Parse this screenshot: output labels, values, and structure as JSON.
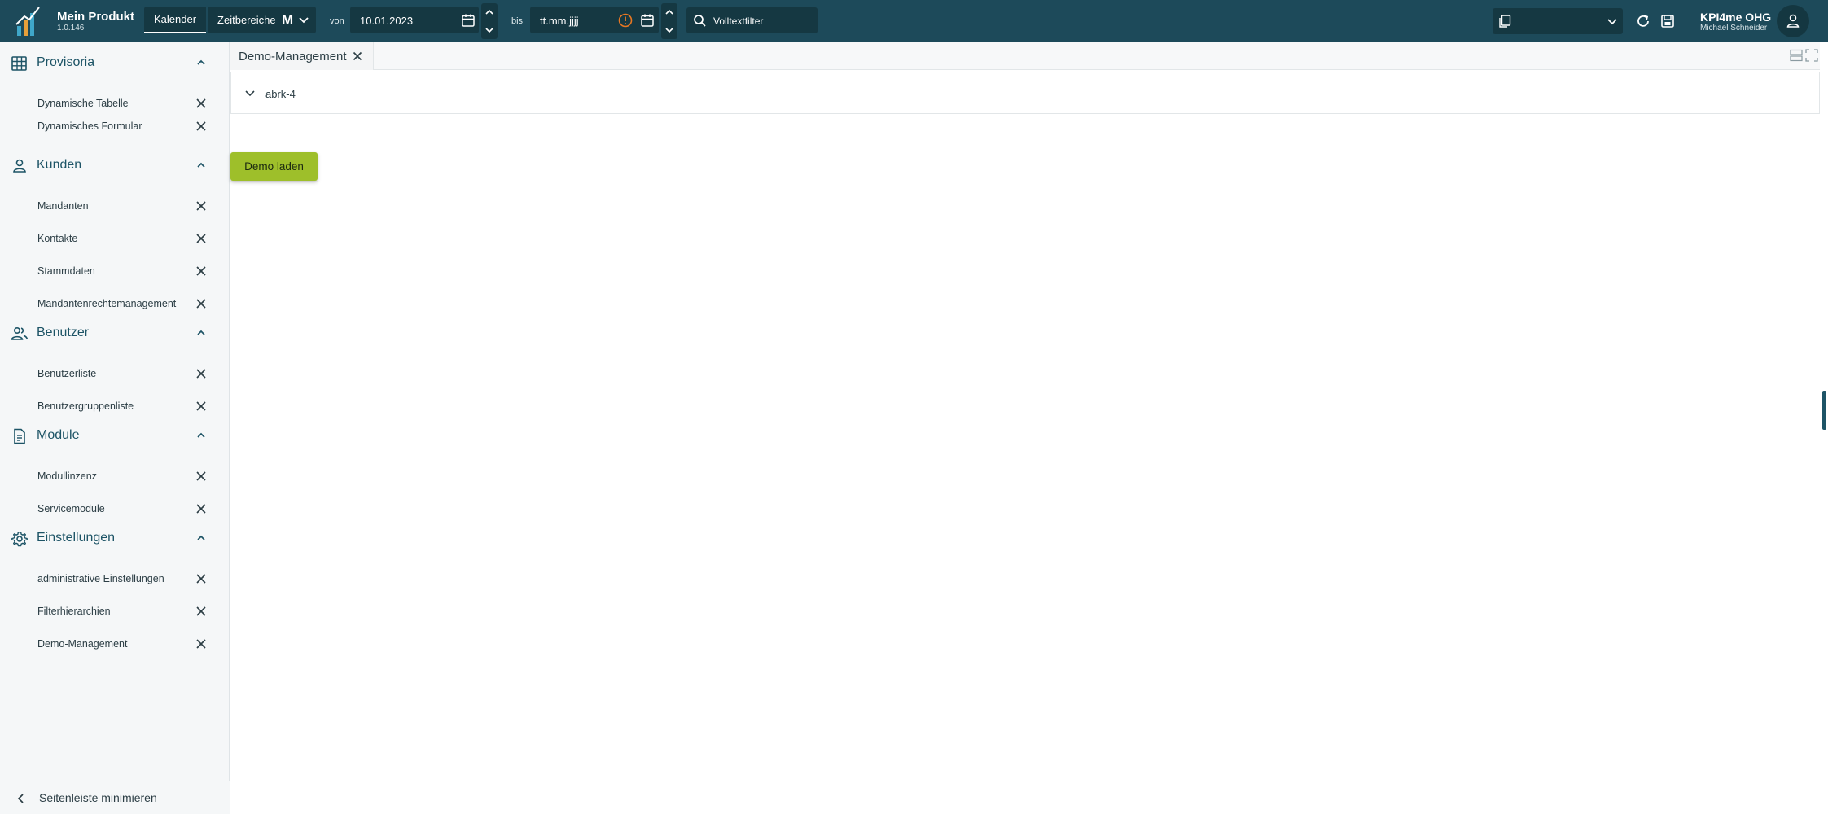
{
  "header": {
    "app_name": "Mein Produkt",
    "version": "1.0.146",
    "view_tabs": [
      "Kalender",
      "Zeitbereiche"
    ],
    "mode": "M",
    "from_label": "von",
    "from_value": "10.01.2023",
    "to_label": "bis",
    "to_value": "tt.mm.jjjj",
    "search_placeholder": "Volltextfilter",
    "company": "KPI4me OHG",
    "user": "Michael Schneider"
  },
  "sidebar": {
    "groups": [
      {
        "title": "Provisoria",
        "icon": "table-icon",
        "items": [
          "Dynamische Tabelle",
          "Dynamisches Formular"
        ]
      },
      {
        "title": "Kunden",
        "icon": "person-icon",
        "items": [
          "Mandanten",
          "Kontakte",
          "Stammdaten",
          "Mandantenrechtemanagement"
        ]
      },
      {
        "title": "Benutzer",
        "icon": "users-icon",
        "items": [
          "Benutzerliste",
          "Benutzergruppenliste"
        ]
      },
      {
        "title": "Module",
        "icon": "document-icon",
        "items": [
          "Modullinzenz",
          "Servicemodule"
        ]
      },
      {
        "title": "Einstellungen",
        "icon": "gear-icon",
        "items": [
          "administrative Einstellungen",
          "Filterhierarchien",
          "Demo-Management"
        ]
      }
    ],
    "footer_label": "Seitenleiste minimieren"
  },
  "main": {
    "tab_label": "Demo-Management",
    "panel_title": "abrk-4",
    "demo_button_label": "Demo laden"
  },
  "colors": {
    "header_bg": "#1d4a5a",
    "accent_green": "#9ebf2a",
    "warning_orange": "#e87722"
  }
}
